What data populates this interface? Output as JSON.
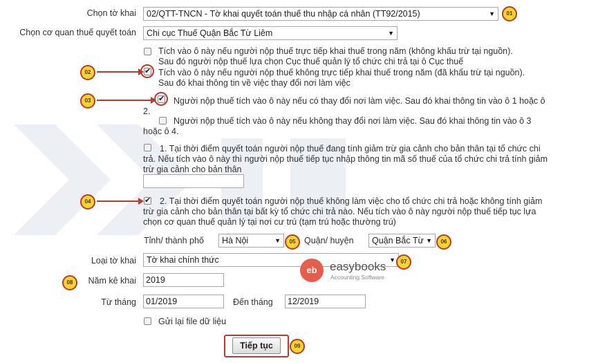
{
  "form": {
    "to_khai_label": "Chọn tờ khai",
    "to_khai_value": "02/QTT-TNCN - Tờ khai quyết toán thuế thu nhập cá nhân (TT92/2015)",
    "co_quan_label": "Chọn cơ quan thuế quyết toán",
    "co_quan_value": "Chi cục Thuế Quận Bắc Từ Liêm",
    "opt1_line1": "Tích vào ô này nếu người nộp thuế trực tiếp khai thuế trong năm (không khấu trừ tại nguồn).",
    "opt1_line2": "Sau đó người nộp thuế lựa chọn Cục thuế quản lý tổ chức chi trả tại ô Cục thuế",
    "opt2_line1": "Tích vào ô này nếu người nộp thuế không trực tiếp khai thuế trong năm (đã khấu trừ tại nguồn).",
    "opt2_line2": "Sau đó khai thông tin về việc thay đổi nơi làm việc",
    "change_line1": "Người nộp thuế tích vào ô này nếu có thay đổi nơi làm việc. Sau đó khai thông tin vào ô 1 hoặc ô",
    "change_line2": "2.",
    "nochange_line1": "Người nộp thuế tích vào ô này nếu không thay đổi nơi làm việc. Sau đó khai thông tin vào ô 3",
    "nochange_line2": "hoặc ô 4.",
    "case1_line1": "1. Tại thời điểm quyết toán người nộp thuế đang tính giảm trừ gia cảnh cho bản thân tại tổ chức chi",
    "case1_line2": "trả. Nếu tích vào ô này thì người nộp thuế tiếp tục nhập thông tin mã số thuế của tổ chức chi trả tính giảm",
    "case1_line3": "trừ gia cảnh cho bản thân",
    "case1_input": "",
    "case2_line1": "2. Tại thời điểm quyết toán người nộp thuế không làm việc cho tổ chức chi trả hoặc không tính giảm",
    "case2_line2": "trừ gia cảnh cho bản thân tại bất kỳ tổ chức chi trả nào. Nếu tích vào ô này người nộp thuế tiếp tục lựa",
    "case2_line3": "chọn cơ quan thuế quản lý tại nơi cư trú (tạm trú hoặc thường trú)",
    "tinh_label": "Tỉnh/ thành phố",
    "tinh_value": "Hà Nội",
    "quan_label": "Quận/ huyện",
    "quan_value": "Quận Bắc Từ",
    "loai_label": "Loại tờ khai",
    "loai_value": "Tờ khai chính thức",
    "nam_label": "Năm kê khai",
    "nam_value": "2019",
    "tu_thang_label": "Từ tháng",
    "tu_thang_value": "01/2019",
    "den_thang_label": "Đến tháng",
    "den_thang_value": "12/2019",
    "gui_lai_label": "Gửi lại file dữ liệu",
    "submit_label": "Tiếp tục"
  },
  "badges": {
    "b01": "01",
    "b02": "02",
    "b03": "03",
    "b04": "04",
    "b05": "05",
    "b06": "06",
    "b07": "07",
    "b08": "08",
    "b09": "09"
  },
  "logo": {
    "mark": "eb",
    "name": "easybooks",
    "tagline": "Accounting Software"
  },
  "colors": {
    "annotation": "#c0392b",
    "badge_fill": "#f6d628",
    "logo": "#e85c4a"
  }
}
